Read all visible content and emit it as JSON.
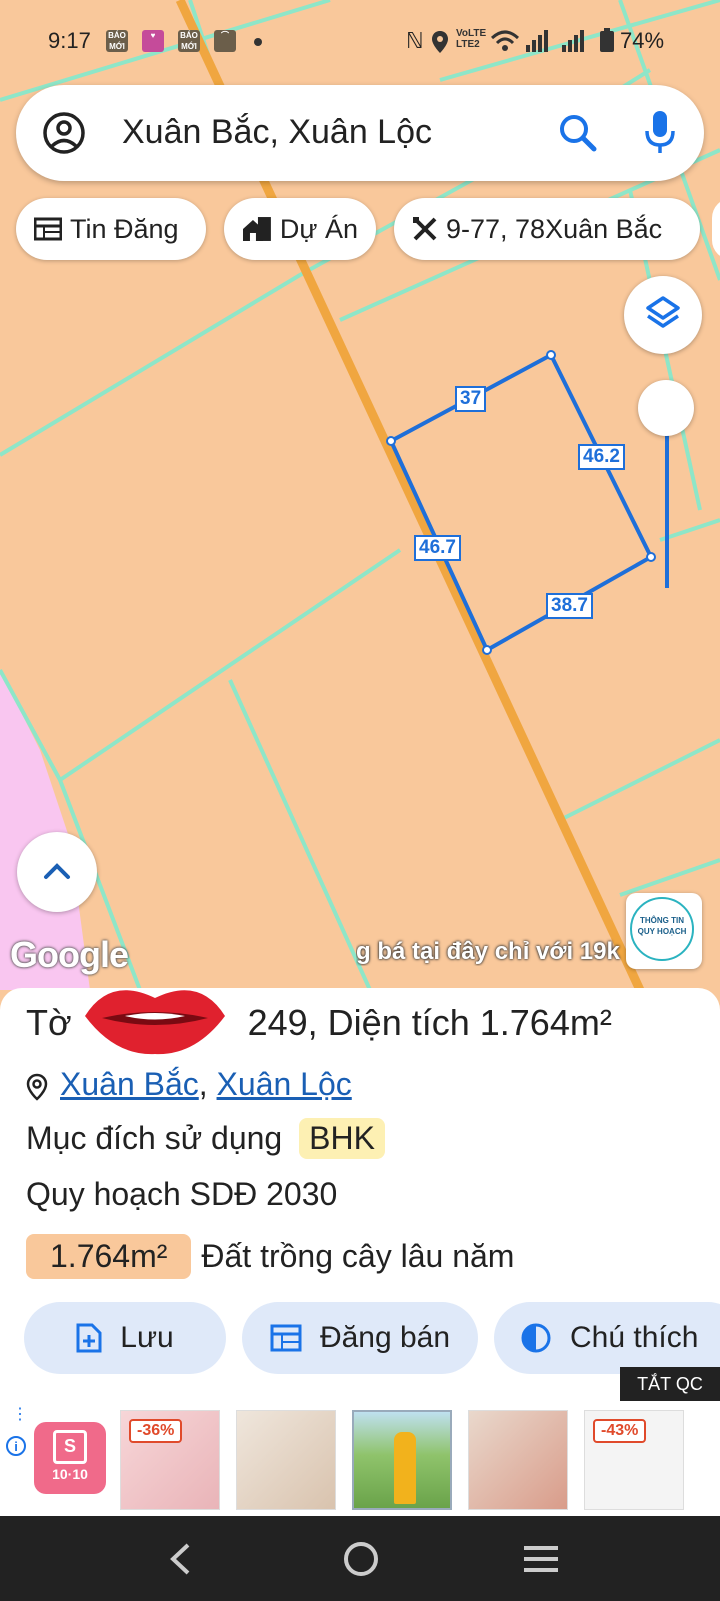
{
  "status_bar": {
    "time": "9:17",
    "apps": [
      {
        "label": "BÁO MỚI",
        "color": "#6b5e4a"
      },
      {
        "label": "",
        "color": "#c54b9a"
      },
      {
        "label": "BÁO MỚI",
        "color": "#6b5e4a"
      },
      {
        "label": "",
        "color": "#6b5e4a"
      }
    ],
    "right_text": "N ◉ VoLTE2 ▾ ▮ ▮ 74%",
    "battery": "74%"
  },
  "search": {
    "query": "Xuân Bắc, Xuân Lộc"
  },
  "chips": [
    {
      "label": "Tin Đăng",
      "icon": "listing-icon"
    },
    {
      "label": "Dự Án",
      "icon": "buildings-icon"
    },
    {
      "label": "9-77, 78Xuân Bắc",
      "icon": "ruler-pencil-icon"
    }
  ],
  "map": {
    "measurements": [
      "37",
      "46.2",
      "46.7",
      "38.7"
    ],
    "google_logo": "Google",
    "promo_text": "g bá tại đây chỉ với 19k",
    "info_badge": "THÔNG TIN QUY HOẠCH",
    "parcel_color": "#f9c89b",
    "boundary_color": "#8ee6c8",
    "road_color": "#f0a640",
    "selection_color": "#1e6fd9",
    "residential_color": "#f9c6f0"
  },
  "sheet": {
    "title": "Tờ 249, Diện tích 1.764m²",
    "title_prefix": "Tờ",
    "title_suffix": "249, Diện tích 1.764m²",
    "loc_ward": "Xuân Bắc",
    "loc_district": "Xuân Lộc",
    "purpose_label": "Mục đích sử dụng",
    "purpose_code": "BHK",
    "plan_label": "Quy hoạch SDĐ 2030",
    "area_value": "1.764m²",
    "area_type": "Đất trồng cây lâu năm"
  },
  "actions": {
    "save": "Lưu",
    "post": "Đăng bán",
    "legend": "Chú thích"
  },
  "ads": {
    "close_label": "TẮT QC",
    "shop_label": "10·10",
    "discount_1": "-36%",
    "discount_2": "-43%"
  }
}
